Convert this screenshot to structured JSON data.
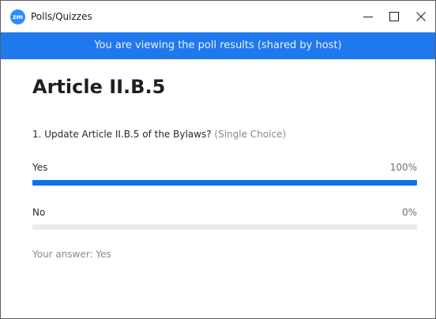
{
  "window": {
    "app_icon": "zm",
    "title": "Polls/Quizzes",
    "buttons": {
      "minimize": "minimize-icon",
      "maximize": "maximize-icon",
      "close": "close-icon"
    }
  },
  "banner": {
    "text": "You are viewing the poll results (shared by host)",
    "color": "#1f78ec"
  },
  "poll": {
    "title": "Article II.B.5",
    "question": "1. Update Article II.B.5 of the Bylaws?",
    "question_type": "(Single Choice)",
    "options": [
      {
        "label": "Yes",
        "percent_label": "100%",
        "fraction": 1.0
      },
      {
        "label": "No",
        "percent_label": "0%",
        "fraction": 0.0
      }
    ],
    "your_answer": "Your answer: Yes",
    "accent_color": "#0e72ed"
  }
}
